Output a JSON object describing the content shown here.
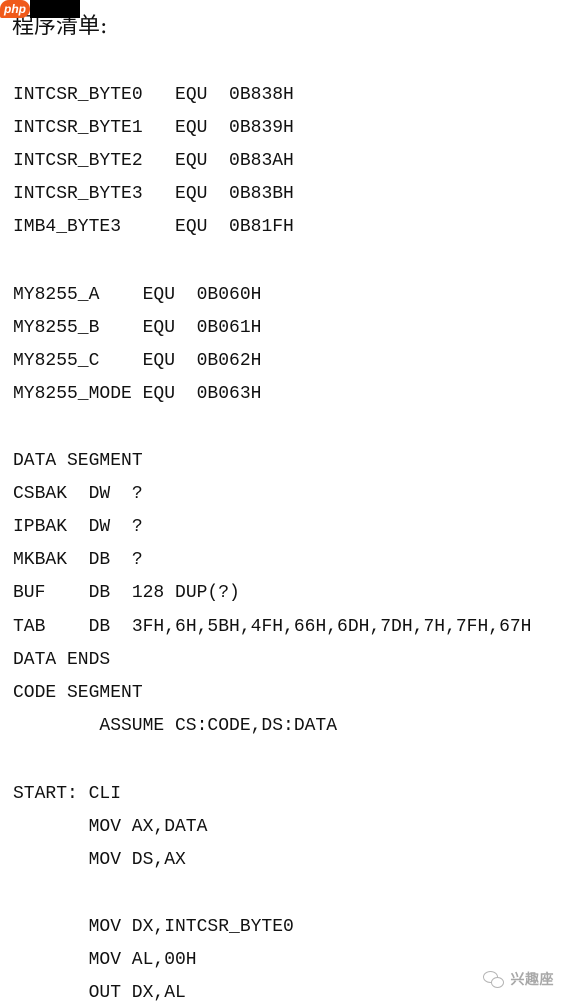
{
  "logo": {
    "text": "php"
  },
  "heading": "程序清单:",
  "code_lines": [
    {
      "col": 0,
      "text": "INTCSR_BYTE0   EQU  0B838H"
    },
    {
      "col": 0,
      "text": "INTCSR_BYTE1   EQU  0B839H"
    },
    {
      "col": 0,
      "text": "INTCSR_BYTE2   EQU  0B83AH"
    },
    {
      "col": 0,
      "text": "INTCSR_BYTE3   EQU  0B83BH"
    },
    {
      "col": 0,
      "text": "IMB4_BYTE3     EQU  0B81FH"
    },
    {
      "col": 0,
      "text": "MY8255_A    EQU  0B060H"
    },
    {
      "col": 0,
      "text": "MY8255_B    EQU  0B061H"
    },
    {
      "col": 0,
      "text": "MY8255_C    EQU  0B062H"
    },
    {
      "col": 0,
      "text": "MY8255_MODE EQU  0B063H"
    },
    {
      "col": 0,
      "text": "DATA SEGMENT"
    },
    {
      "col": 0,
      "text": "CSBAK  DW  ?"
    },
    {
      "col": 0,
      "text": "IPBAK  DW  ?"
    },
    {
      "col": 0,
      "text": "MKBAK  DB  ?"
    },
    {
      "col": 0,
      "text": "BUF    DB  128 DUP(?)"
    },
    {
      "col": 0,
      "text": "TAB    DB  3FH,6H,5BH,4FH,66H,6DH,7DH,7H,7FH,67H"
    },
    {
      "col": 0,
      "text": "DATA ENDS"
    },
    {
      "col": 0,
      "text": "CODE SEGMENT"
    },
    {
      "col": 8,
      "text": "ASSUME CS:CODE,DS:DATA"
    },
    {
      "col": 0,
      "text": "START: CLI"
    },
    {
      "col": 7,
      "text": "MOV AX,DATA"
    },
    {
      "col": 7,
      "text": "MOV DS,AX"
    },
    {
      "col": 7,
      "text": "MOV DX,INTCSR_BYTE0"
    },
    {
      "col": 7,
      "text": "MOV AL,00H"
    },
    {
      "col": 7,
      "text": "OUT DX,AL"
    }
  ],
  "watermark": {
    "text": "兴趣座"
  }
}
